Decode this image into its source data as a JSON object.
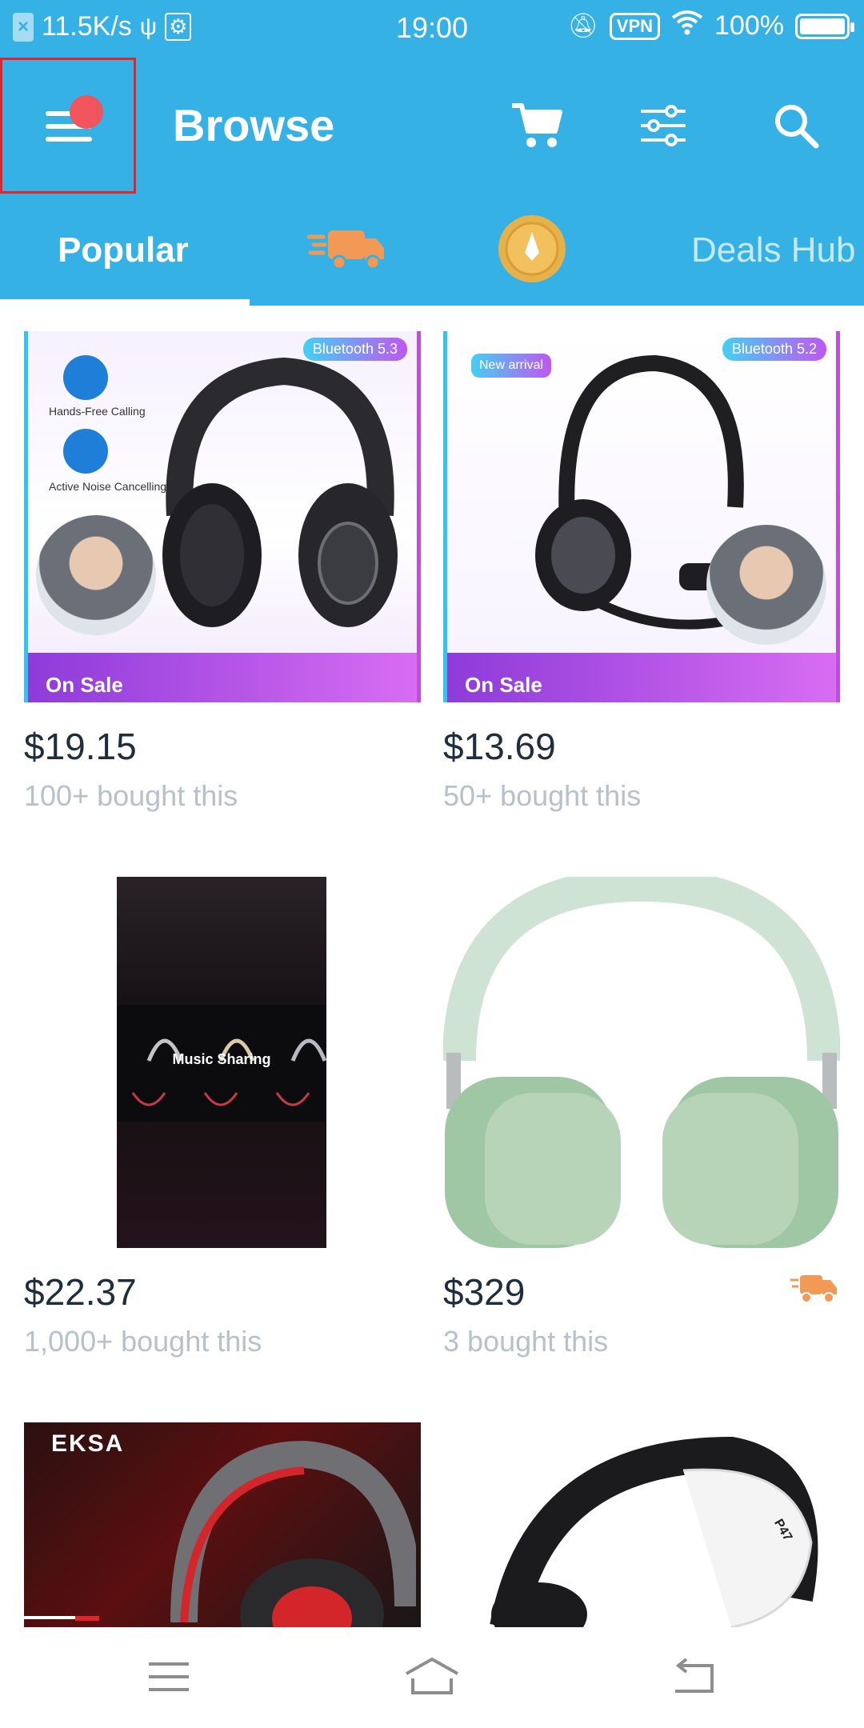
{
  "status_bar": {
    "speed": "11.5K/s",
    "time": "19:00",
    "vpn": "VPN",
    "battery": "100%"
  },
  "header": {
    "title": "Browse"
  },
  "tabs": {
    "popular": "Popular",
    "deals": "Deals Hub"
  },
  "products": [
    {
      "price": "$19.15",
      "bought": "100+ bought this",
      "image_text": {
        "badge": "Bluetooth 5.3",
        "sale": "On Sale",
        "feature1": "Hands-Free Calling",
        "feature2": "Active Noise Cancelling"
      }
    },
    {
      "price": "$13.69",
      "bought": "50+ bought this",
      "image_text": {
        "badge": "Bluetooth 5.2",
        "sale": "On Sale",
        "new": "New arrival"
      }
    },
    {
      "price": "$22.37",
      "bought": "1,000+ bought this",
      "image_text": {
        "label": "Music Sharing"
      }
    },
    {
      "price": "$329",
      "bought": "3 bought this",
      "shipping_icon": "delivery-truck-icon"
    },
    {
      "image_text": {
        "brand": "EKSA"
      }
    },
    {
      "image_text": {
        "model": "P47"
      }
    }
  ],
  "colors": {
    "brand_blue": "#35b1e6",
    "price_text": "#1f2d3d",
    "muted_text": "#b6c1c9",
    "truck_orange": "#f29a55",
    "highlight_red": "#e0262b"
  }
}
